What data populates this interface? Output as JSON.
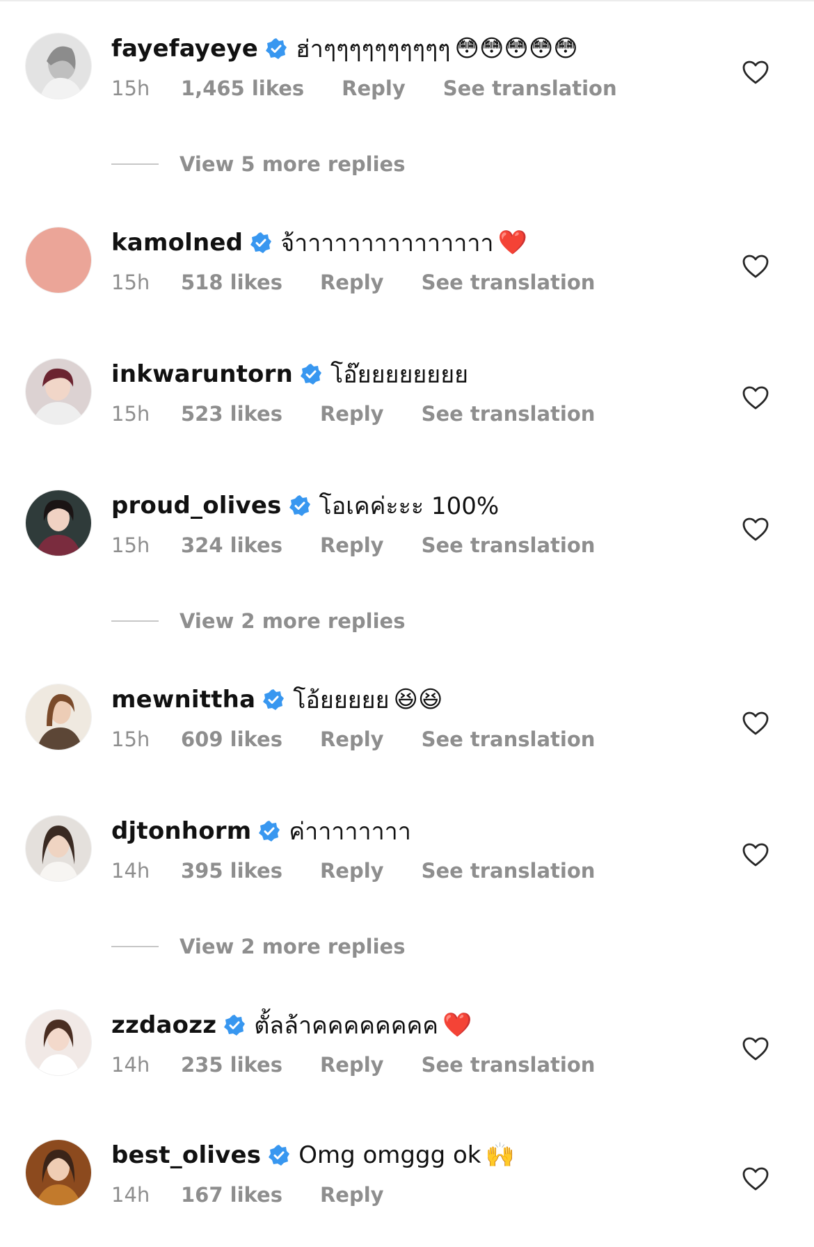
{
  "comments": [
    {
      "username": "fayefayeye",
      "text": "ฮ่าๆๆๆๆๆๆๆๆๆๆ",
      "emoji": "😳😳😳😳😳",
      "time": "15h",
      "likes": "1,465 likes",
      "reply": "Reply",
      "translation": "See translation",
      "avatar_color": "#d9d9d9"
    },
    {
      "username": "kamolned",
      "text": "จ้าาาาาาาาาาาาาาา",
      "emoji": "❤️",
      "time": "15h",
      "likes": "518 likes",
      "reply": "Reply",
      "translation": "See translation",
      "avatar_color": "#eba598"
    },
    {
      "username": "inkwaruntorn",
      "text": "โอ๊ยยยยยยยย",
      "emoji": "",
      "time": "15h",
      "likes": "523 likes",
      "reply": "Reply",
      "translation": "See translation",
      "avatar_color": "#b9a6a8"
    },
    {
      "username": "proud_olives",
      "text": "โอเคค่ะะะ 100%",
      "emoji": "",
      "time": "15h",
      "likes": "324 likes",
      "reply": "Reply",
      "translation": "See translation",
      "avatar_color": "#5e3a3f"
    },
    {
      "username": "mewnittha",
      "text": "โอ้ยยยยย",
      "emoji": "😆😆",
      "time": "15h",
      "likes": "609 likes",
      "reply": "Reply",
      "translation": "See translation",
      "avatar_color": "#c9a98a"
    },
    {
      "username": "djtonhorm",
      "text": "ค่าาาาาาาา",
      "emoji": "",
      "time": "14h",
      "likes": "395 likes",
      "reply": "Reply",
      "translation": "See translation",
      "avatar_color": "#8a7468"
    },
    {
      "username": "zzdaozz",
      "text": "ตั้ลล้าคคคคคคคค",
      "emoji": "❤️",
      "time": "14h",
      "likes": "235 likes",
      "reply": "Reply",
      "translation": "See translation",
      "avatar_color": "#e2c1b6"
    },
    {
      "username": "best_olives",
      "text": "Omg omggg ok",
      "emoji": "🙌",
      "time": "14h",
      "likes": "167 likes",
      "reply": "Reply",
      "translation": "",
      "avatar_color": "#a55a25"
    }
  ],
  "view_more": [
    "View 5 more replies",
    "View 2 more replies",
    "View 2 more replies"
  ],
  "colors": {
    "verified_badge": "#3897f0",
    "muted_text": "#8e8e8e",
    "username_text": "#111111"
  },
  "icons": {
    "verified": "verified-badge-icon",
    "like": "heart-outline-icon"
  }
}
